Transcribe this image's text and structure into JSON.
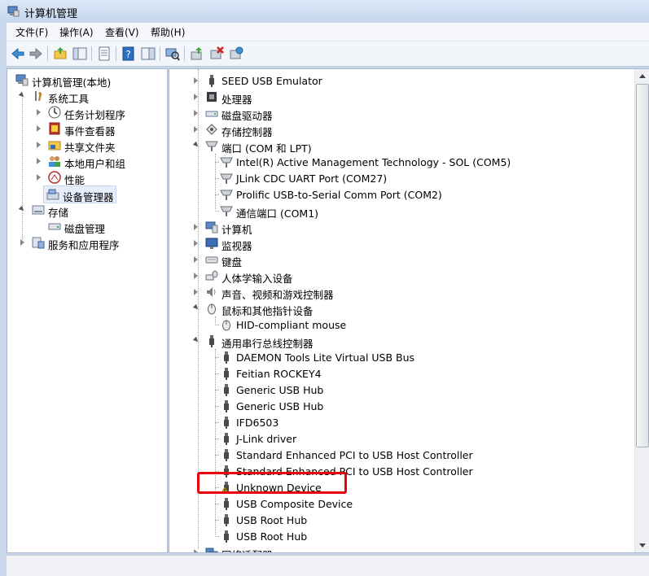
{
  "window": {
    "title": "计算机管理"
  },
  "menu": [
    "文件(F)",
    "操作(A)",
    "查看(V)",
    "帮助(H)"
  ],
  "toolbar": [
    "back-icon",
    "forward-icon",
    "up-folder-icon",
    "show-tree-icon",
    "properties-icon",
    "help-icon",
    "show-pane-icon",
    "scan-icon",
    "update-driver-icon",
    "disable-icon",
    "uninstall-icon"
  ],
  "left_tree": [
    {
      "label": "计算机管理(本地)",
      "icon": "computer-management-icon"
    },
    {
      "label": "系统工具",
      "icon": "tools-icon"
    },
    {
      "label": "任务计划程序",
      "icon": "clock-icon"
    },
    {
      "label": "事件查看器",
      "icon": "event-viewer-icon"
    },
    {
      "label": "共享文件夹",
      "icon": "shared-folder-icon"
    },
    {
      "label": "本地用户和组",
      "icon": "users-icon"
    },
    {
      "label": "性能",
      "icon": "performance-icon"
    },
    {
      "label": "设备管理器",
      "icon": "device-manager-icon"
    },
    {
      "label": "存储",
      "icon": "storage-icon"
    },
    {
      "label": "磁盘管理",
      "icon": "disk-icon"
    },
    {
      "label": "服务和应用程序",
      "icon": "services-icon"
    }
  ],
  "device_tree": [
    {
      "label": "SEED USB Emulator",
      "icon": "usb-plug-icon"
    },
    {
      "label": "处理器",
      "icon": "cpu-icon"
    },
    {
      "label": "磁盘驱动器",
      "icon": "disk-drive-icon"
    },
    {
      "label": "存储控制器",
      "icon": "storage-controller-icon"
    },
    {
      "label": "端口 (COM 和 LPT)",
      "icon": "port-icon"
    },
    {
      "label": "Intel(R) Active Management Technology - SOL (COM5)",
      "icon": "port-icon"
    },
    {
      "label": "JLink CDC UART Port (COM27)",
      "icon": "port-icon"
    },
    {
      "label": "Prolific USB-to-Serial Comm Port (COM2)",
      "icon": "port-icon"
    },
    {
      "label": "通信端口 (COM1)",
      "icon": "port-icon"
    },
    {
      "label": "计算机",
      "icon": "computer-icon"
    },
    {
      "label": "监视器",
      "icon": "monitor-icon"
    },
    {
      "label": "键盘",
      "icon": "keyboard-icon"
    },
    {
      "label": "人体学输入设备",
      "icon": "hid-icon"
    },
    {
      "label": "声音、视频和游戏控制器",
      "icon": "speaker-icon"
    },
    {
      "label": "鼠标和其他指针设备",
      "icon": "mouse-icon"
    },
    {
      "label": "HID-compliant mouse",
      "icon": "mouse-icon"
    },
    {
      "label": "通用串行总线控制器",
      "icon": "usb-plug-icon"
    },
    {
      "label": "DAEMON Tools Lite Virtual USB Bus",
      "icon": "usb-plug-icon"
    },
    {
      "label": "Feitian ROCKEY4",
      "icon": "usb-plug-icon"
    },
    {
      "label": "Generic USB Hub",
      "icon": "usb-plug-icon"
    },
    {
      "label": "Generic USB Hub",
      "icon": "usb-plug-icon"
    },
    {
      "label": "IFD6503",
      "icon": "usb-plug-icon"
    },
    {
      "label": "J-Link driver",
      "icon": "usb-plug-icon"
    },
    {
      "label": "Standard Enhanced PCI to USB Host Controller",
      "icon": "usb-plug-icon"
    },
    {
      "label": "Standard Enhanced PCI to USB Host Controller",
      "icon": "usb-plug-icon"
    },
    {
      "label": "Unknown Device",
      "icon": "warning-usb-icon"
    },
    {
      "label": "USB Composite Device",
      "icon": "usb-plug-icon"
    },
    {
      "label": "USB Root Hub",
      "icon": "usb-plug-icon"
    },
    {
      "label": "USB Root Hub",
      "icon": "usb-plug-icon"
    },
    {
      "label": "网络适配器",
      "icon": "network-icon"
    }
  ],
  "colors": {
    "highlight": "#e8000b",
    "selection": "#e6eefb"
  }
}
